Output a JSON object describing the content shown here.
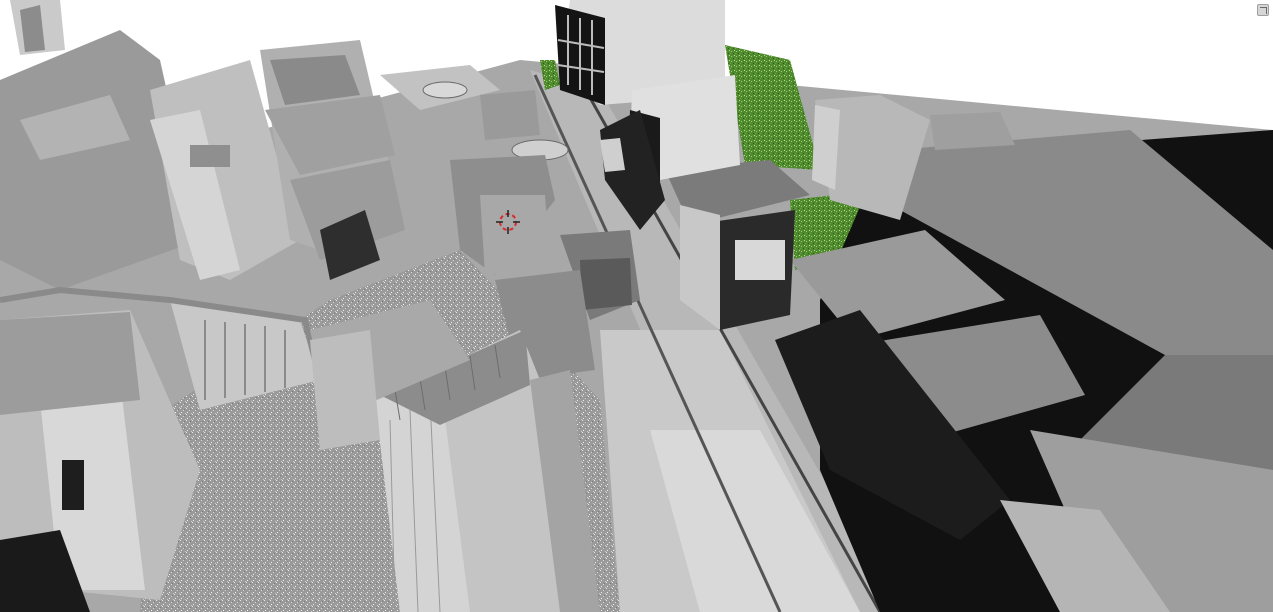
{
  "app": {
    "view": "3D viewport",
    "shading": "solid",
    "cursor": "3d-cursor-icon"
  },
  "colors": {
    "background": "#ffffff",
    "grass": "#4f8a2e",
    "cursor_red": "#d62b2b"
  },
  "viewport": {
    "corner_button_icon": "maximize-icon"
  }
}
